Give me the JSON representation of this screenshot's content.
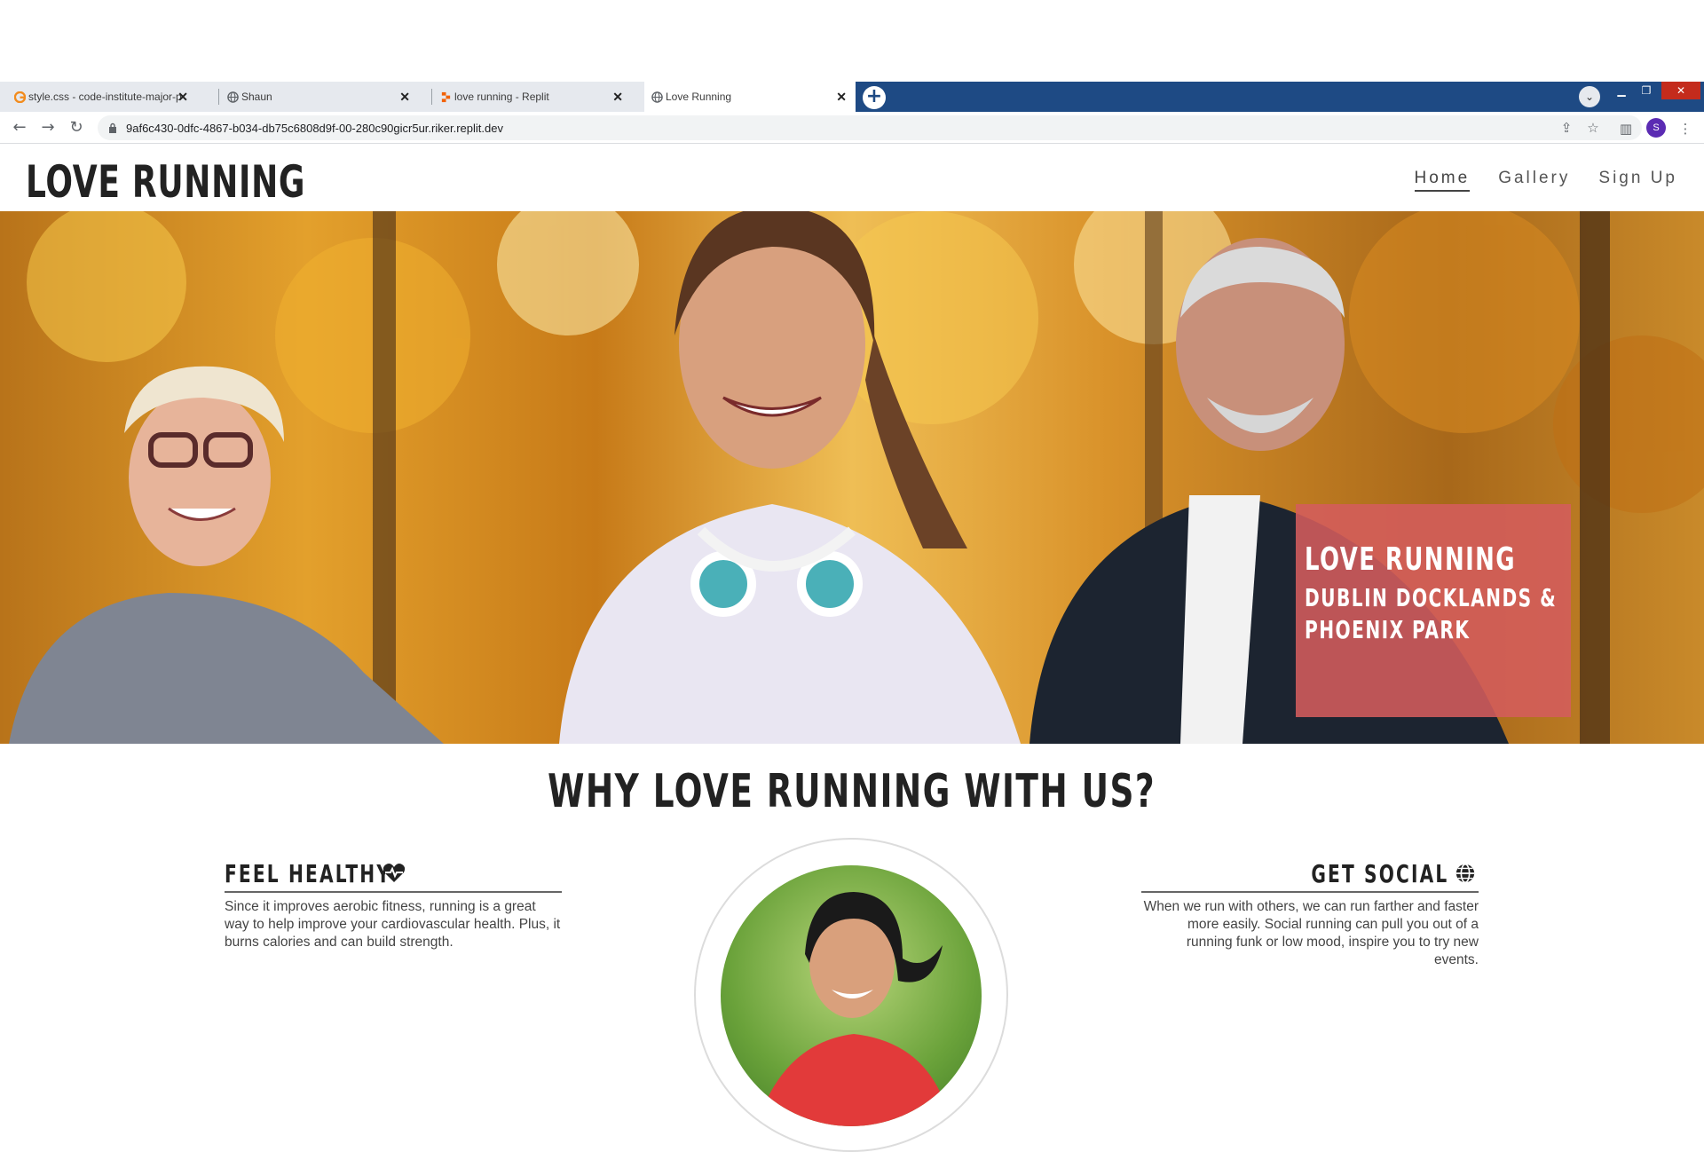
{
  "browser": {
    "tabs": [
      {
        "title": "style.css - code-institute-major-p",
        "active": false
      },
      {
        "title": "Shaun",
        "active": false
      },
      {
        "title": "love running - Replit",
        "active": false
      },
      {
        "title": "Love Running",
        "active": true
      }
    ],
    "url": "9af6c430-0dfc-4867-b034-db75c6808d9f-00-280c90gicr5ur.riker.replit.dev",
    "profile_initial": "S",
    "colors": {
      "tabstrip_dark": "#1e4a84",
      "close_red": "#c42b1c",
      "avatar": "#5b2bb3"
    }
  },
  "site": {
    "logo": "LOVE RUNNING",
    "nav": [
      {
        "label": "Home",
        "active": true
      },
      {
        "label": "Gallery",
        "active": false
      },
      {
        "label": "Sign Up",
        "active": false
      }
    ],
    "hero": {
      "title": "LOVE RUNNING",
      "subtitle": "DUBLIN DOCKLANDS & PHOENIX PARK",
      "card_color": "#d45c5c"
    },
    "section_title": "WHY LOVE RUNNING WITH US?",
    "features": [
      {
        "heading": "FEEL HEALTHY",
        "icon": "heartbeat-icon",
        "body": "Since it improves aerobic fitness, running is a great way to help improve your cardiovascular health. Plus, it burns calories and can build strength."
      },
      {
        "heading": "GET SOCIAL",
        "icon": "globe-icon",
        "body": "When we run with others, we can run farther and faster more easily. Social running can pull you out of a running funk or low mood, inspire you to try new events."
      }
    ]
  }
}
